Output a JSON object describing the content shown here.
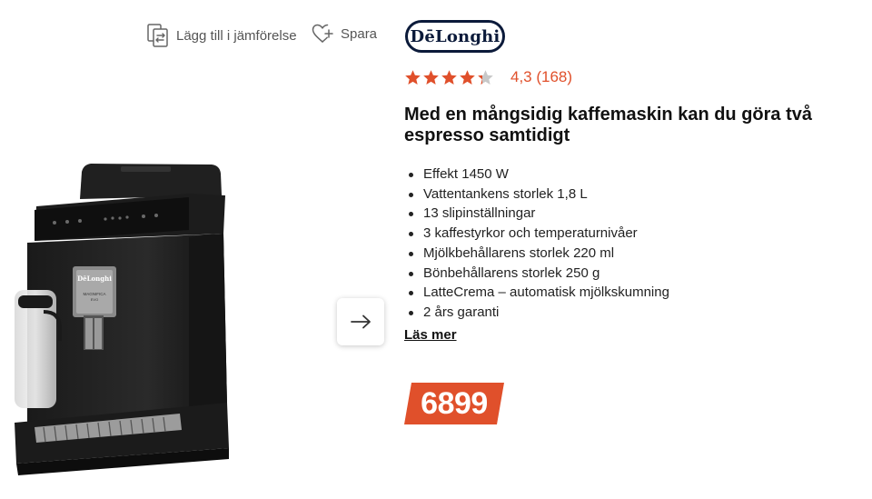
{
  "actions": {
    "compare_label": "Lägg till i jämförelse",
    "save_label": "Spara"
  },
  "brand": {
    "logo_text": "DēLonghi"
  },
  "product": {
    "rating_value": 4.3,
    "rating_stars_filled": 4.3,
    "rating_stars_total": 5,
    "rating_text": "4,3 (168)",
    "title": "Med en mångsidig kaffemaskin kan du göra två espresso samtidigt",
    "specs": [
      "Effekt 1450 W",
      "Vattentankens storlek 1,8 L",
      "13 slipinställningar",
      "3 kaffestyrkor och temperaturnivåer",
      "Mjölkbehållarens storlek 220 ml",
      "Bönbehållarens storlek 250 g",
      "LatteCrema – automatisk mjölkskumning",
      "2 års garanti"
    ],
    "read_more_label": "Läs mer",
    "price": "6899",
    "machine_label_brand": "DēLonghi",
    "machine_label_model": "MAGNIFICA",
    "machine_label_sub": "EVO"
  },
  "colors": {
    "accent": "#e0502b",
    "star_empty": "#c8c8c8",
    "brand_navy": "#0b1a3a"
  },
  "icons": {
    "compare": "compare-icon",
    "save": "heart-plus-icon",
    "next": "arrow-right-icon",
    "star": "star-icon"
  }
}
